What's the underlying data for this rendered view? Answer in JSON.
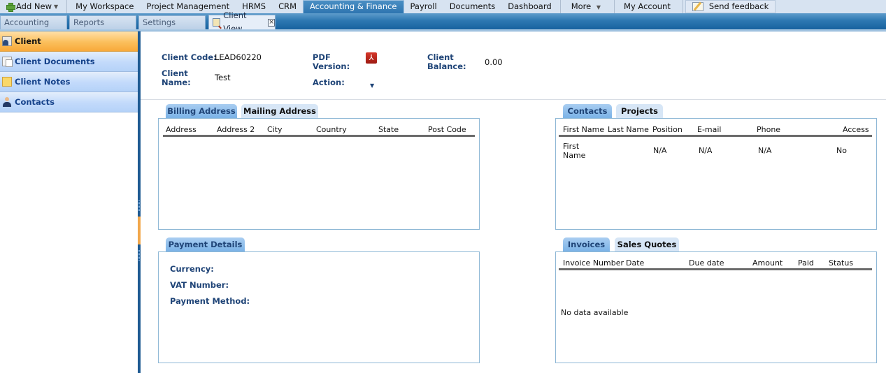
{
  "topnav": {
    "add_new": "Add New",
    "items": [
      "My Workspace",
      "Project Management",
      "HRMS",
      "CRM",
      "Accounting & Finance",
      "Payroll",
      "Documents",
      "Dashboard"
    ],
    "more": "More",
    "my_account": "My Account",
    "send_feedback": "Send feedback",
    "active": "Accounting & Finance"
  },
  "tabs": {
    "items": [
      "Accounting",
      "Reports",
      "Settings"
    ],
    "active_tab": "Client View"
  },
  "sidebar": {
    "items": [
      {
        "label": "Client",
        "icon": "client-icon",
        "active": true
      },
      {
        "label": "Client Documents",
        "icon": "documents-icon",
        "active": false
      },
      {
        "label": "Client Notes",
        "icon": "notes-icon",
        "active": false
      },
      {
        "label": "Contacts",
        "icon": "contacts-icon",
        "active": false
      }
    ]
  },
  "client": {
    "code_label": "Client Code:",
    "code": "LEAD60220",
    "name_label_1": "Client",
    "name_label_2": "Name:",
    "name": "Test",
    "pdf_label_1": "PDF",
    "pdf_label_2": "Version:",
    "action_label": "Action:",
    "balance_label_1": "Client",
    "balance_label_2": "Balance:",
    "balance": "0.00"
  },
  "address_panel": {
    "tabs": [
      "Billing Address",
      "Mailing Address"
    ],
    "columns": [
      "Address",
      "Address 2",
      "City",
      "Country",
      "State",
      "Post Code"
    ]
  },
  "contacts_panel": {
    "tabs": [
      "Contacts",
      "Projects"
    ],
    "columns": [
      "First Name",
      "Last Name",
      "Position",
      "E-mail",
      "Phone",
      "Access"
    ],
    "rows": [
      {
        "first_name_1": "First",
        "first_name_2": "Name",
        "last_name": "",
        "position": "N/A",
        "email": "N/A",
        "phone": "N/A",
        "access": "No"
      }
    ]
  },
  "payment_panel": {
    "tabs": [
      "Payment Details"
    ],
    "fields": [
      "Currency:",
      "VAT Number:",
      "Payment Method:"
    ]
  },
  "invoices_panel": {
    "tabs": [
      "Invoices",
      "Sales Quotes"
    ],
    "columns": [
      "Invoice Number",
      "Date",
      "Due date",
      "Amount",
      "Paid",
      "Status"
    ],
    "empty_text": "No data available"
  }
}
